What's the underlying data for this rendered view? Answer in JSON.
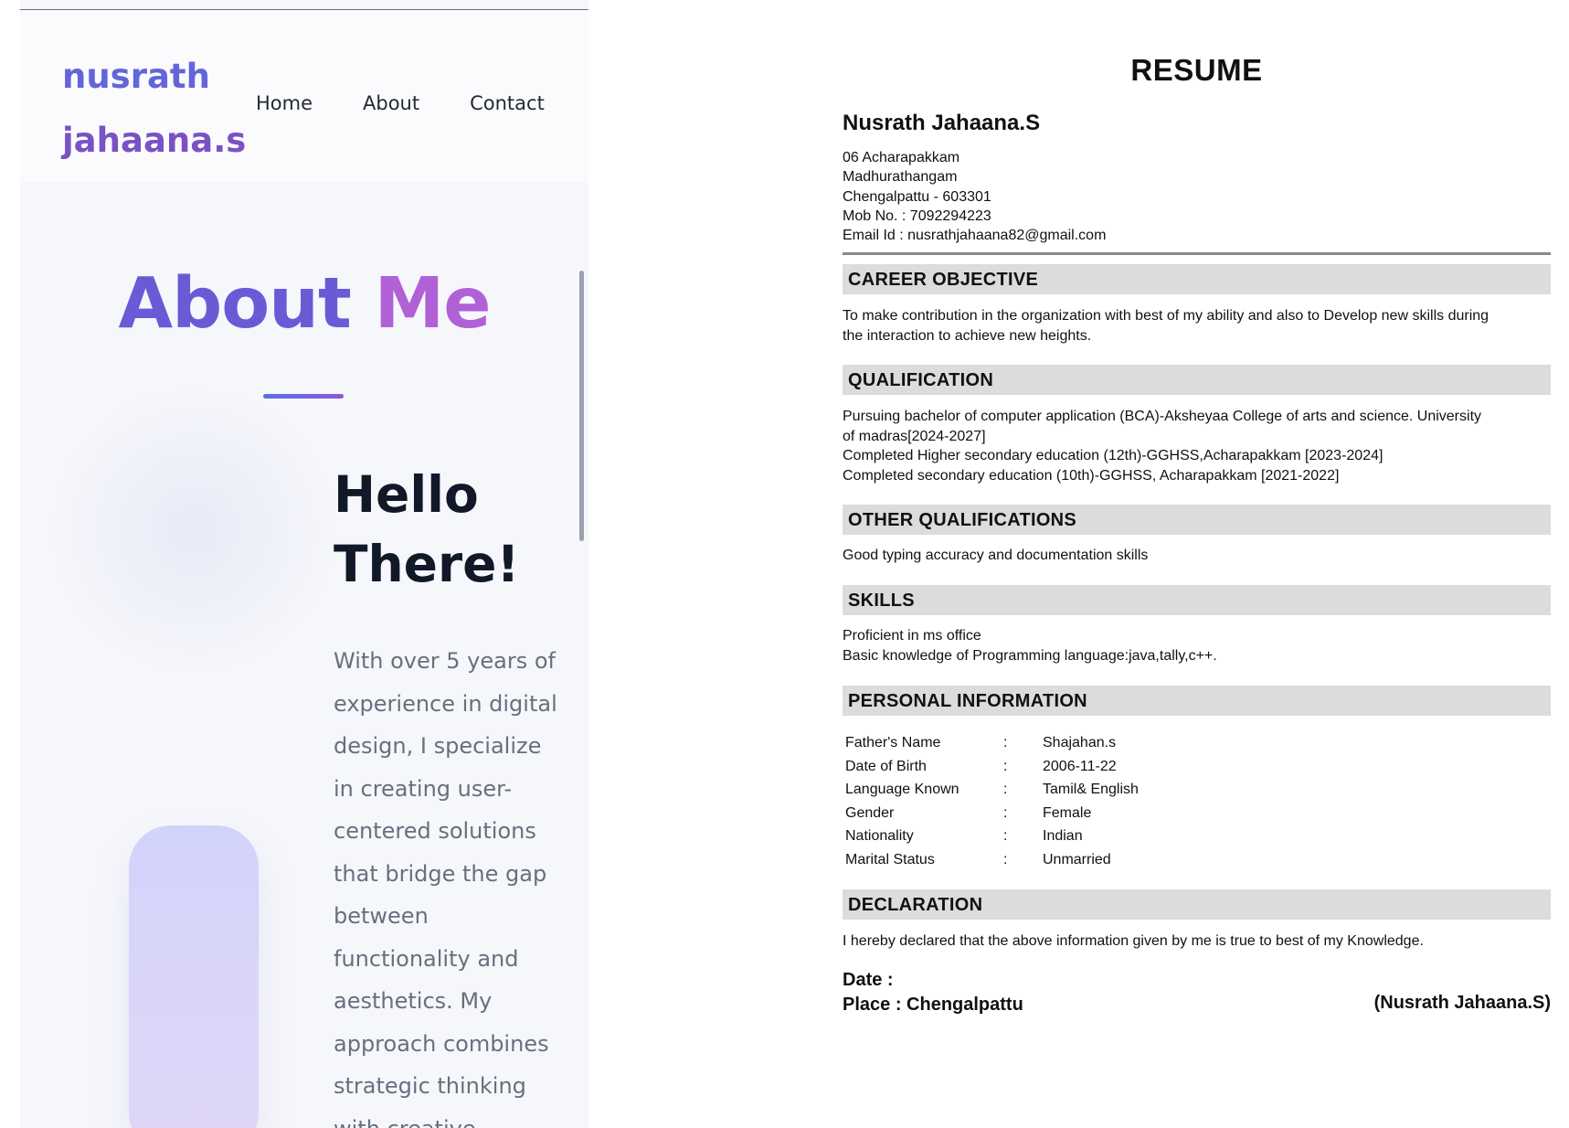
{
  "site": {
    "brand": {
      "line1": "nusrath",
      "line2": "jahaana.s"
    },
    "nav": [
      "Home",
      "About",
      "Contact"
    ],
    "about": {
      "title_part1": "About",
      "title_part2": "Me"
    },
    "hello": {
      "line1": "Hello",
      "line2": "There!"
    },
    "bio_lines": [
      "With over 5 years of",
      "experience in digital",
      "design, I specialize",
      "in creating user-",
      "centered solutions",
      "that bridge the gap",
      "between",
      "functionality and",
      "aesthetics. My",
      "approach combines",
      "strategic thinking",
      "with creative"
    ]
  },
  "resume": {
    "title": "RESUME",
    "name": "Nusrath Jahaana.S",
    "address_lines": [
      "06 Acharapakkam",
      "Madhurathangam",
      "Chengalpattu - 603301",
      "Mob No. : 7092294223",
      "Email Id : nusrathjahaana82@gmail.com"
    ],
    "sections": {
      "career": {
        "heading": "CAREER OBJECTIVE",
        "lines": [
          "To make contribution in the organization with best of my ability and also to Develop new skills during",
          "the interaction to achieve new heights."
        ]
      },
      "qualification": {
        "heading": "QUALIFICATION",
        "lines": [
          "Pursuing bachelor of computer application (BCA)-Aksheyaa College of arts and science. University",
          "of madras[2024-2027]",
          "Completed Higher secondary education (12th)-GGHSS,Acharapakkam [2023-2024]",
          "Completed secondary education (10th)-GGHSS, Acharapakkam [2021-2022]"
        ]
      },
      "other": {
        "heading": "OTHER QUALIFICATIONS",
        "lines": [
          "Good typing accuracy and documentation skills"
        ]
      },
      "skills": {
        "heading": "SKILLS",
        "lines": [
          "Proficient in ms office",
          "Basic knowledge of Programming language:java,tally,c++."
        ]
      },
      "personal": {
        "heading": "PERSONAL INFORMATION",
        "rows": [
          {
            "key": "Father's Name",
            "sep": ":",
            "value": "Shajahan.s"
          },
          {
            "key": "Date of Birth",
            "sep": ":",
            "value": "2006-11-22"
          },
          {
            "key": "Language Known",
            "sep": ":",
            "value": "Tamil& English"
          },
          {
            "key": "Gender",
            "sep": ":",
            "value": "Female"
          },
          {
            "key": "Nationality",
            "sep": ":",
            "value": "Indian"
          },
          {
            "key": "Marital Status",
            "sep": ":",
            "value": "Unmarried"
          }
        ]
      },
      "declaration": {
        "heading": "DECLARATION",
        "lines": [
          "I hereby declared that the above information given by me is true to best of my Knowledge."
        ]
      }
    },
    "date_label": "Date :",
    "place_label": "Place : Chengalpattu",
    "signature": "(Nusrath Jahaana.S)"
  }
}
